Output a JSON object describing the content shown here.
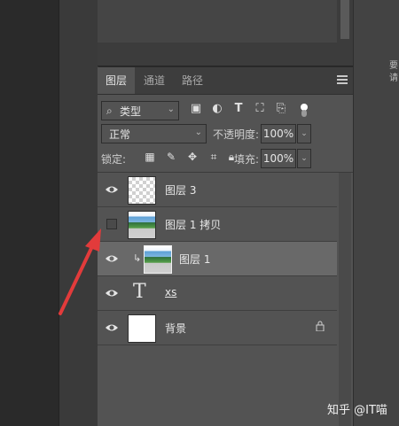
{
  "side_hint": "要\n请",
  "tabs": [
    "图层",
    "通道",
    "路径"
  ],
  "filter": {
    "label": "类型"
  },
  "blend": {
    "mode": "正常",
    "opacity_label": "不透明度:",
    "opacity": "100%"
  },
  "lock": {
    "label": "锁定:",
    "fill_label": "填充:",
    "fill": "100%"
  },
  "layers": [
    {
      "name": "图层 3",
      "visible": true,
      "thumb": "transparent"
    },
    {
      "name": "图层 1 拷贝",
      "visible": false,
      "thumb": "photo"
    },
    {
      "name": "图层 1",
      "visible": true,
      "thumb": "photo",
      "clipped": true,
      "selected": true
    },
    {
      "name": "xs",
      "visible": true,
      "thumb": "text"
    },
    {
      "name": "背景",
      "visible": true,
      "thumb": "white",
      "locked": true
    }
  ],
  "watermark": "知乎 @IT喵",
  "colors": {
    "panel": "#535353",
    "selected": "#696969",
    "arrow": "#e23b3b"
  }
}
